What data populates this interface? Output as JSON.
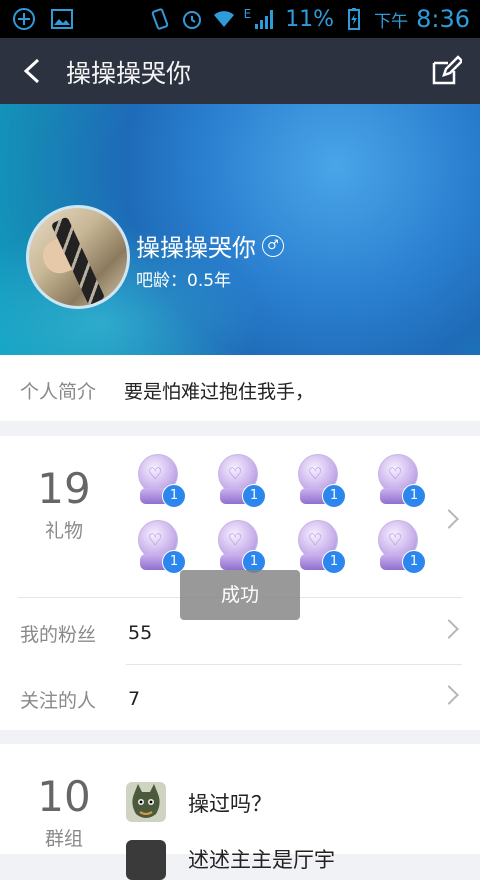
{
  "status_bar": {
    "battery_percent": "11%",
    "period": "下午",
    "time": "8:36",
    "network": "E",
    "accent_color": "#2e9bdb"
  },
  "title_bar": {
    "title": "操操操哭你",
    "back_icon": "chevron-left-icon",
    "edit_icon": "edit-icon"
  },
  "profile": {
    "name": "操操操哭你",
    "gender_symbol": "♂",
    "age": "吧龄：0.5年"
  },
  "intro": {
    "label": "个人简介",
    "text": "要是怕难过抱住我手，"
  },
  "gifts": {
    "count": "19",
    "label": "礼物",
    "items": [
      {
        "badge": "1"
      },
      {
        "badge": "1"
      },
      {
        "badge": "1"
      },
      {
        "badge": "1"
      },
      {
        "badge": "1"
      },
      {
        "badge": "1"
      },
      {
        "badge": "1"
      },
      {
        "badge": "1"
      }
    ]
  },
  "fans": {
    "label": "我的粉丝",
    "value": "55"
  },
  "following": {
    "label": "关注的人",
    "value": "7"
  },
  "toast": {
    "text": "成功"
  },
  "groups": {
    "count": "10",
    "label": "群组",
    "items": [
      {
        "name": "操过吗？"
      },
      {
        "name": "述述主主是厅宇"
      }
    ]
  }
}
